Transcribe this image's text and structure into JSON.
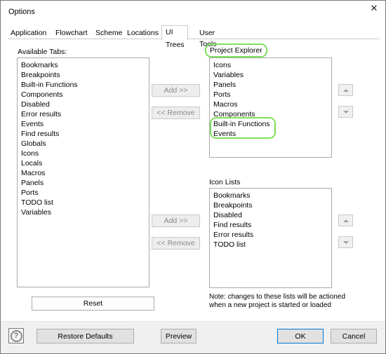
{
  "window": {
    "title": "Options",
    "close_icon": "close-icon"
  },
  "tabs": [
    {
      "label": "Application",
      "active": false
    },
    {
      "label": "Flowchart",
      "active": false
    },
    {
      "label": "Scheme",
      "active": false
    },
    {
      "label": "Locations",
      "active": false
    },
    {
      "label": "UI Trees",
      "active": true
    },
    {
      "label": "User Tools",
      "active": false
    }
  ],
  "available_tabs": {
    "label": "Available Tabs:",
    "items": [
      "Bookmarks",
      "Breakpoints",
      "Built-in Functions",
      "Components",
      "Disabled",
      "Error results",
      "Events",
      "Find results",
      "Globals",
      "Icons",
      "Locals",
      "Macros",
      "Panels",
      "Ports",
      "TODO list",
      "Variables"
    ],
    "reset_label": "Reset"
  },
  "project_explorer": {
    "label": "Project Explorer",
    "items": [
      "Icons",
      "Variables",
      "Panels",
      "Ports",
      "Macros",
      "Components",
      "Built-in Functions",
      "Events"
    ],
    "add_label": "Add >>",
    "remove_label": "<< Remove"
  },
  "icon_lists": {
    "label": "Icon Lists",
    "items": [
      "Bookmarks",
      "Breakpoints",
      "Disabled",
      "Find results",
      "Error results",
      "TODO list"
    ],
    "add_label": "Add >>",
    "remove_label": "<< Remove"
  },
  "note": {
    "line1": "Note: changes to these lists will be actioned",
    "line2": "when a new project is started or loaded"
  },
  "footer": {
    "help_glyph": "?",
    "restore_defaults_label": "Restore Defaults",
    "preview_label": "Preview",
    "ok_label": "OK",
    "cancel_label": "Cancel"
  },
  "colors": {
    "highlight": "#7ce05a",
    "ok_border": "#0078d7"
  }
}
